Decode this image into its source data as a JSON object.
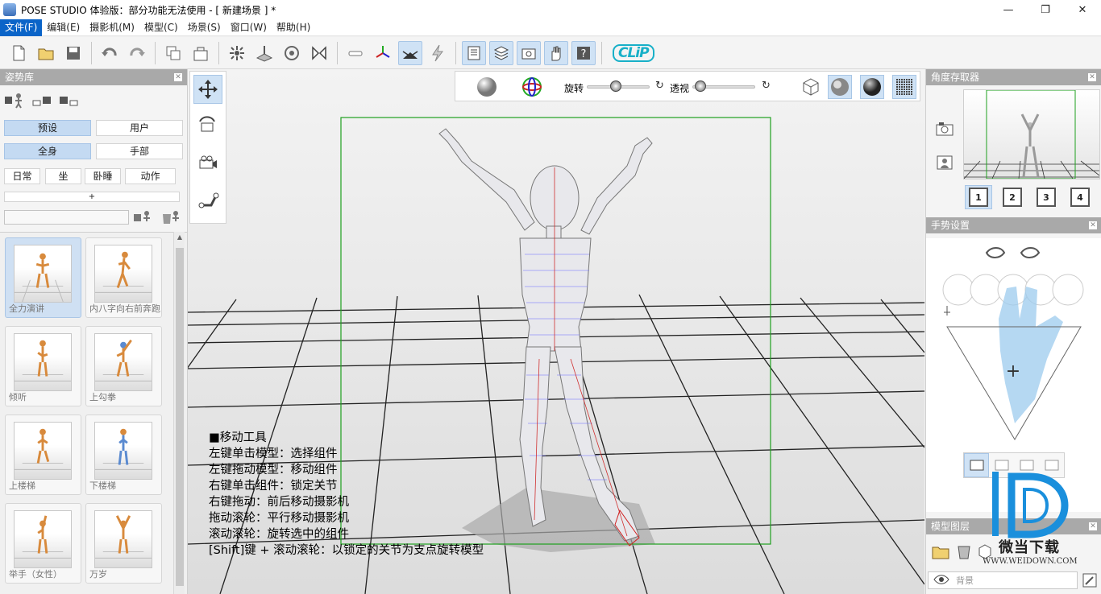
{
  "window": {
    "title": "POSE STUDIO 体验版：部分功能无法使用 - [  新建场景  ] *",
    "minimize": "—",
    "maximize": "❐",
    "close": "✕"
  },
  "menu": [
    "文件(F)",
    "编辑(E)",
    "摄影机(M)",
    "模型(C)",
    "场景(S)",
    "窗口(W)",
    "帮助(H)"
  ],
  "toolbar": {
    "clip_logo": "CLiP"
  },
  "left_panel": {
    "title": "姿势库",
    "tabs_source": [
      "预设",
      "用户"
    ],
    "tabs_body": [
      "全身",
      "手部"
    ],
    "categories": [
      "日常",
      "坐",
      "卧睡",
      "动作"
    ],
    "add_label": "+",
    "poses": [
      {
        "label": "全力演讲"
      },
      {
        "label": "内八字向右前奔跑"
      },
      {
        "label": "倾听"
      },
      {
        "label": "上勾拳"
      },
      {
        "label": "上楼梯"
      },
      {
        "label": "下楼梯"
      },
      {
        "label": "举手（女性）"
      },
      {
        "label": "万岁"
      }
    ]
  },
  "view_toolbar": {
    "rotate_label": "旋转",
    "perspective_label": "透视",
    "reset_glyph": "↻",
    "rotate_value": 0.45,
    "perspective_value": 0.05
  },
  "help": {
    "lines": [
      "■移动工具",
      "左键单击模型：选择组件",
      "左键拖动模型：移动组件",
      "右键单击组件：锁定关节",
      "右键拖动：前后移动摄影机",
      "拖动滚轮：平行移动摄影机",
      "滚动滚轮：旋转选中的组件",
      "[Shift]键 + 滚动滚轮：以锁定的关节为支点旋转模型"
    ]
  },
  "right_panel": {
    "angle_title": "角度存取器",
    "slots": [
      "1",
      "2",
      "3",
      "4"
    ],
    "gesture_title": "手势设置",
    "gesture_plus": "+",
    "layers_title": "模型图层",
    "layer_background": "背景"
  },
  "watermark": {
    "brand": "微当下载",
    "url": "WWW.WEIDOWN.COM"
  },
  "colors": {
    "accent": "#0a64c8",
    "panel_header": "#a9a9a9",
    "selected": "#c4daf2",
    "selection_box": "#1ea01e"
  }
}
